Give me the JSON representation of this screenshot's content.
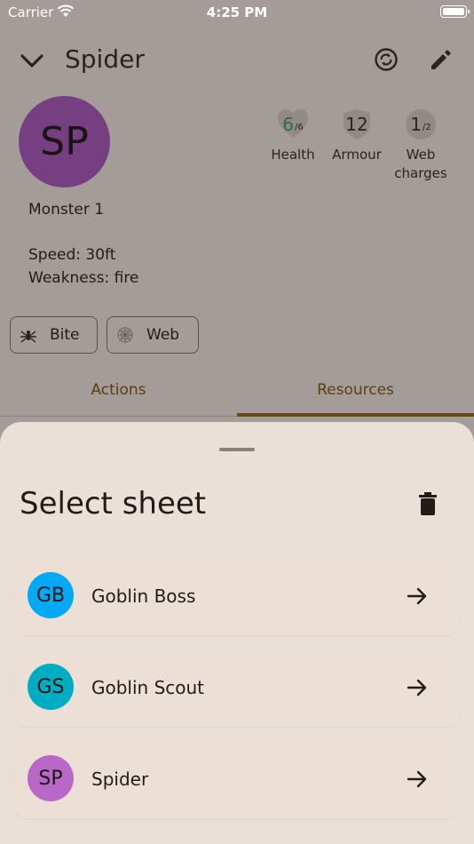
{
  "status_bar": {
    "carrier": "Carrier",
    "time": "4:25 PM"
  },
  "header": {
    "title": "Spider"
  },
  "creature": {
    "initials": "SP",
    "avatar_color": "#753f81",
    "subtitle": "Monster 1",
    "speed": "Speed: 30ft",
    "weakness": "Weakness: fire"
  },
  "stats": [
    {
      "value": "6",
      "max": "/6",
      "label": "Health",
      "value_color": "#2f6a45"
    },
    {
      "value": "12",
      "max": "",
      "label": "Armour"
    },
    {
      "value": "1",
      "max": "/2",
      "label_line1": "Web",
      "label_line2": "charges"
    }
  ],
  "chips": [
    {
      "label": "Bite",
      "icon": "spider-icon"
    },
    {
      "label": "Web",
      "icon": "web-icon"
    }
  ],
  "tabs": [
    {
      "label": "Actions",
      "active": false
    },
    {
      "label": "Resources",
      "active": true
    }
  ],
  "sheet": {
    "title": "Select sheet",
    "items": [
      {
        "initials": "GB",
        "name": "Goblin Boss",
        "color": "#03a9f4"
      },
      {
        "initials": "GS",
        "name": "Goblin Scout",
        "color": "#00acc1"
      },
      {
        "initials": "SP",
        "name": "Spider",
        "color": "#ba68c8"
      }
    ]
  }
}
